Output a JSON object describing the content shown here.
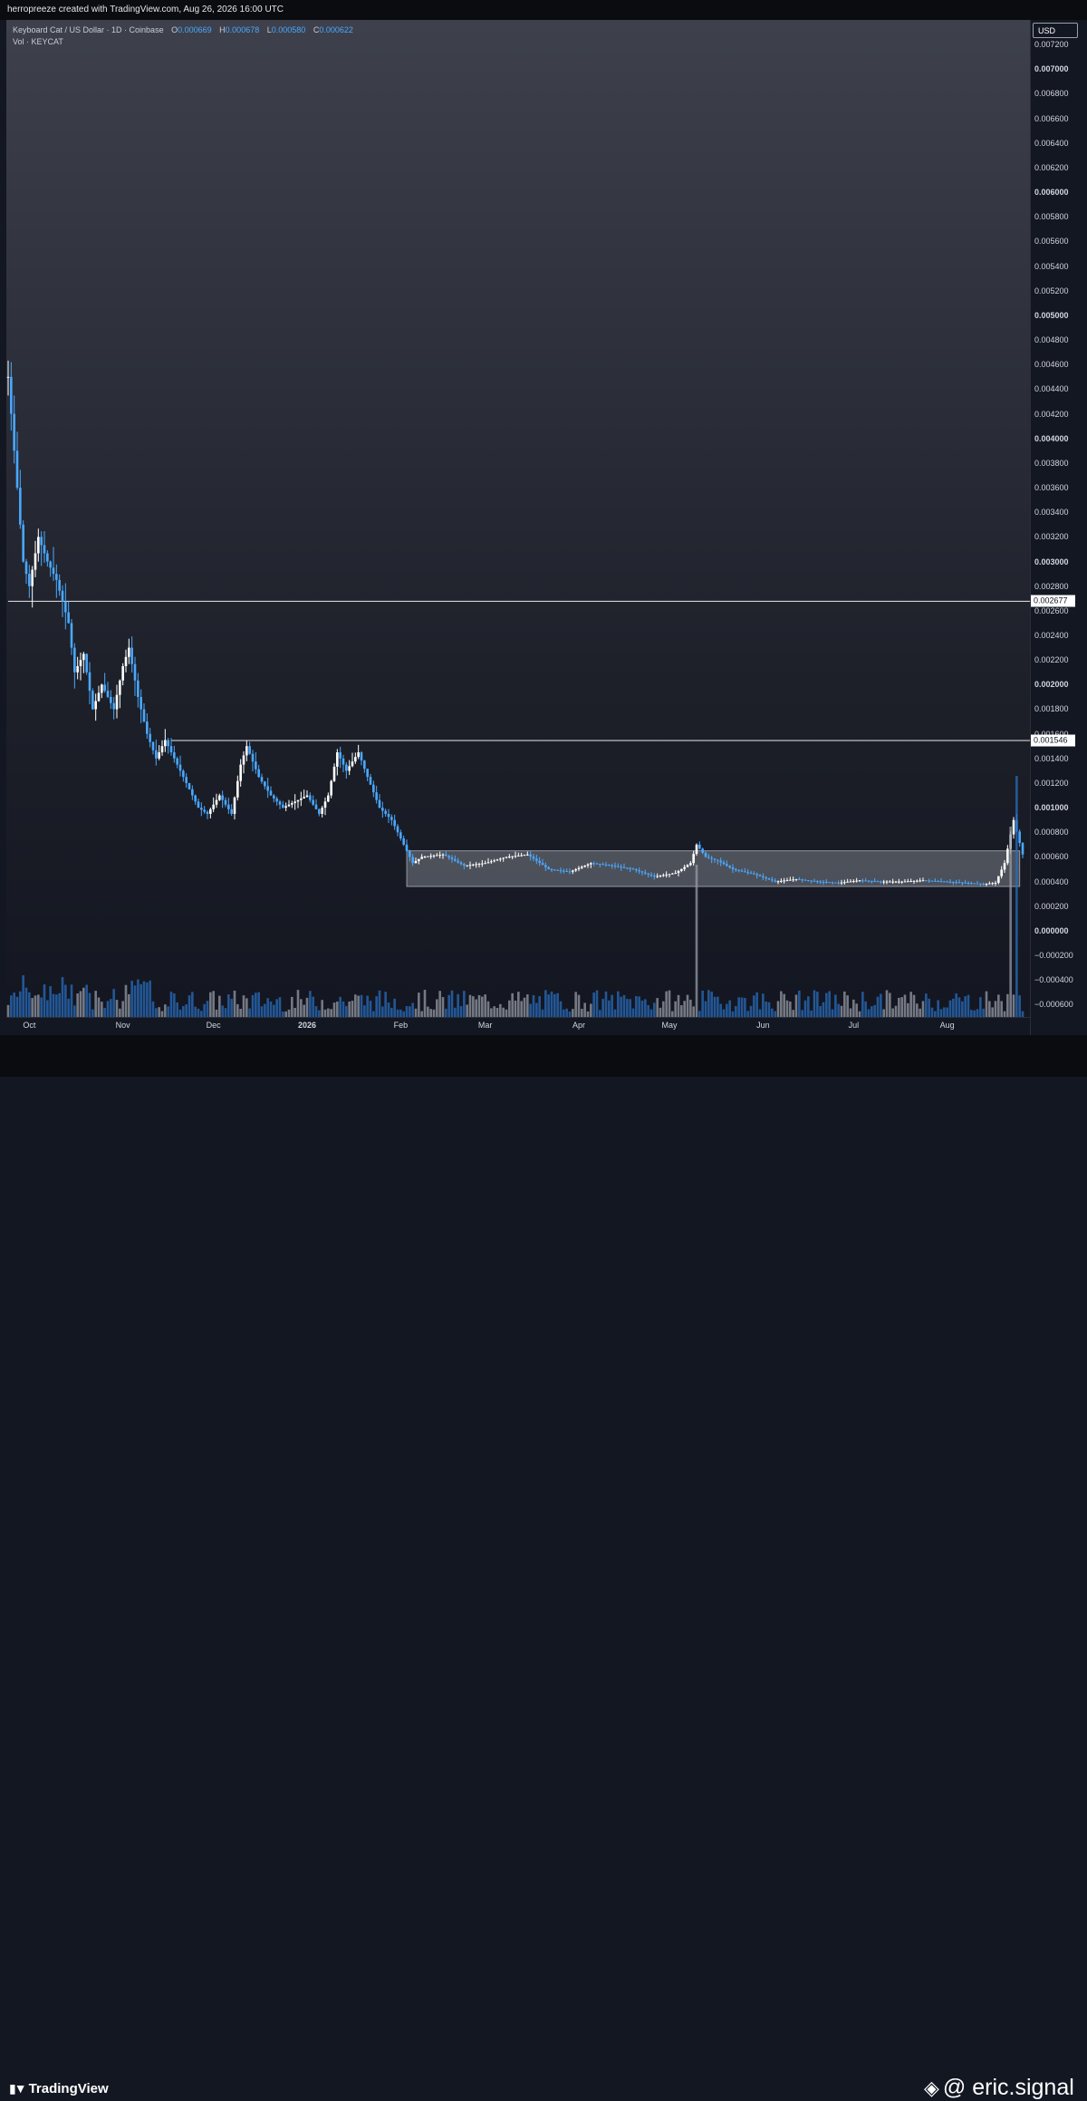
{
  "header": {
    "attribution": "herropreeze created with TradingView.com, Aug 26, 2026 16:00 UTC"
  },
  "legend": {
    "symbol": "Keyboard Cat / US Dollar · 1D · Coinbase",
    "o_label": "O",
    "o_value": "0.000669",
    "h_label": "H",
    "h_value": "0.000678",
    "l_label": "L",
    "l_value": "0.000580",
    "c_label": "C",
    "c_value": "0.000622",
    "volume": "Vol · KEYCAT"
  },
  "price_scale": {
    "currency": "USD",
    "levels": [
      {
        "label": "0.007200",
        "major": false
      },
      {
        "label": "0.007000",
        "major": true
      },
      {
        "label": "0.006800",
        "major": false
      },
      {
        "label": "0.006600",
        "major": false
      },
      {
        "label": "0.006400",
        "major": false
      },
      {
        "label": "0.006200",
        "major": false
      },
      {
        "label": "0.006000",
        "major": true
      },
      {
        "label": "0.005800",
        "major": false
      },
      {
        "label": "0.005600",
        "major": false
      },
      {
        "label": "0.005400",
        "major": false
      },
      {
        "label": "0.005200",
        "major": false
      },
      {
        "label": "0.005000",
        "major": true
      },
      {
        "label": "0.004800",
        "major": false
      },
      {
        "label": "0.004600",
        "major": false
      },
      {
        "label": "0.004400",
        "major": false
      },
      {
        "label": "0.004200",
        "major": false
      },
      {
        "label": "0.004000",
        "major": true
      },
      {
        "label": "0.003800",
        "major": false
      },
      {
        "label": "0.003600",
        "major": false
      },
      {
        "label": "0.003400",
        "major": false
      },
      {
        "label": "0.003200",
        "major": false
      },
      {
        "label": "0.003000",
        "major": true
      },
      {
        "label": "0.002800",
        "major": false
      },
      {
        "label": "0.002600",
        "major": false
      },
      {
        "label": "0.002400",
        "major": false
      },
      {
        "label": "0.002200",
        "major": false
      },
      {
        "label": "0.002000",
        "major": true
      },
      {
        "label": "0.001800",
        "major": false
      },
      {
        "label": "0.001600",
        "major": false
      },
      {
        "label": "0.001400",
        "major": false
      },
      {
        "label": "0.001200",
        "major": false
      },
      {
        "label": "0.001000",
        "major": true
      },
      {
        "label": "0.000800",
        "major": false
      },
      {
        "label": "0.000600",
        "major": false
      },
      {
        "label": "0.000400",
        "major": false
      },
      {
        "label": "0.000200",
        "major": false
      },
      {
        "label": "0.000000",
        "major": true
      },
      {
        "label": "−0.000200",
        "major": false
      },
      {
        "label": "−0.000400",
        "major": false
      },
      {
        "label": "−0.000600",
        "major": false
      }
    ]
  },
  "time_scale": {
    "months": [
      {
        "label": "Oct",
        "year": false
      },
      {
        "label": "Nov",
        "year": false
      },
      {
        "label": "Dec",
        "year": false
      },
      {
        "label": "2026",
        "year": true
      },
      {
        "label": "Feb",
        "year": false
      },
      {
        "label": "Mar",
        "year": false
      },
      {
        "label": "Apr",
        "year": false
      },
      {
        "label": "May",
        "year": false
      },
      {
        "label": "Jun",
        "year": false
      },
      {
        "label": "Jul",
        "year": false
      },
      {
        "label": "Aug",
        "year": false
      }
    ]
  },
  "chart_data": {
    "type": "candlestick",
    "title": "Keyboard Cat / US Dollar · 1D · Coinbase",
    "x_start": "2025-09-24",
    "x_end": "2026-08-26",
    "ylim": [
      -0.0007,
      0.0074
    ],
    "grid": false,
    "up_color": "#ffffff",
    "down_color": "#4aa8ff",
    "close_path": [
      [
        "2025-09-24",
        0.0045
      ],
      [
        "2025-09-27",
        0.0036
      ],
      [
        "2025-09-29",
        0.003
      ],
      [
        "2025-10-01",
        0.0028
      ],
      [
        "2025-10-04",
        0.0032
      ],
      [
        "2025-10-07",
        0.003
      ],
      [
        "2025-10-10",
        0.00285
      ],
      [
        "2025-10-14",
        0.0025
      ],
      [
        "2025-10-16",
        0.0021
      ],
      [
        "2025-10-19",
        0.00225
      ],
      [
        "2025-10-22",
        0.0018
      ],
      [
        "2025-10-25",
        0.002
      ],
      [
        "2025-10-29",
        0.0018
      ],
      [
        "2025-11-01",
        0.00215
      ],
      [
        "2025-11-03",
        0.0023
      ],
      [
        "2025-11-06",
        0.0019
      ],
      [
        "2025-11-09",
        0.0016
      ],
      [
        "2025-11-12",
        0.0014
      ],
      [
        "2025-11-15",
        0.00155
      ],
      [
        "2025-11-18",
        0.0014
      ],
      [
        "2025-11-22",
        0.0012
      ],
      [
        "2025-11-26",
        0.001
      ],
      [
        "2025-11-29",
        0.00095
      ],
      [
        "2025-12-03",
        0.0011
      ],
      [
        "2025-12-07",
        0.00095
      ],
      [
        "2025-12-10",
        0.00135
      ],
      [
        "2025-12-12",
        0.0015
      ],
      [
        "2025-12-16",
        0.00125
      ],
      [
        "2025-12-20",
        0.0011
      ],
      [
        "2025-12-24",
        0.001
      ],
      [
        "2025-12-28",
        0.00105
      ],
      [
        "2026-01-01",
        0.0011
      ],
      [
        "2026-01-05",
        0.00095
      ],
      [
        "2026-01-08",
        0.0011
      ],
      [
        "2026-01-11",
        0.00145
      ],
      [
        "2026-01-14",
        0.0013
      ],
      [
        "2026-01-18",
        0.00145
      ],
      [
        "2026-01-21",
        0.00125
      ],
      [
        "2026-01-25",
        0.001
      ],
      [
        "2026-01-29",
        0.0009
      ],
      [
        "2026-02-02",
        0.0007
      ],
      [
        "2026-02-05",
        0.00055
      ],
      [
        "2026-02-08",
        0.0006
      ],
      [
        "2026-02-15",
        0.00062
      ],
      [
        "2026-02-22",
        0.00053
      ],
      [
        "2026-03-01",
        0.00055
      ],
      [
        "2026-03-08",
        0.0006
      ],
      [
        "2026-03-15",
        0.00062
      ],
      [
        "2026-03-22",
        0.0005
      ],
      [
        "2026-03-29",
        0.00048
      ],
      [
        "2026-04-05",
        0.00055
      ],
      [
        "2026-04-12",
        0.00053
      ],
      [
        "2026-04-19",
        0.0005
      ],
      [
        "2026-04-26",
        0.00044
      ],
      [
        "2026-05-03",
        0.00047
      ],
      [
        "2026-05-08",
        0.00055
      ],
      [
        "2026-05-10",
        0.0007
      ],
      [
        "2026-05-13",
        0.0006
      ],
      [
        "2026-05-17",
        0.00057
      ],
      [
        "2026-05-22",
        0.0005
      ],
      [
        "2026-05-29",
        0.00046
      ],
      [
        "2026-06-05",
        0.0004
      ],
      [
        "2026-06-12",
        0.00042
      ],
      [
        "2026-06-19",
        0.0004
      ],
      [
        "2026-06-26",
        0.00039
      ],
      [
        "2026-07-03",
        0.00041
      ],
      [
        "2026-07-10",
        0.0004
      ],
      [
        "2026-07-17",
        0.0004
      ],
      [
        "2026-07-24",
        0.00041
      ],
      [
        "2026-07-31",
        0.0004
      ],
      [
        "2026-08-07",
        0.00039
      ],
      [
        "2026-08-13",
        0.00038
      ],
      [
        "2026-08-17",
        0.00039
      ],
      [
        "2026-08-20",
        0.00055
      ],
      [
        "2026-08-23",
        0.0009
      ],
      [
        "2026-08-26",
        0.00062
      ]
    ],
    "horizontal_levels": [
      {
        "label": "0.002677",
        "value": 0.002677,
        "from": "2025-09-24"
      },
      {
        "label": "0.001546",
        "value": 0.001546,
        "from": "2025-11-17"
      }
    ],
    "range_box": {
      "from": "2026-02-03",
      "to": "2026-08-25",
      "low": 0.00036,
      "high": 0.00065
    },
    "volume_spikes": [
      {
        "date": "2026-05-10",
        "level": 0.6
      },
      {
        "date": "2026-08-22",
        "level": 0.75
      },
      {
        "date": "2026-08-24",
        "level": 0.95
      }
    ]
  },
  "branding": {
    "tradingview": "TradingView",
    "handle": "@ eric.signal"
  }
}
